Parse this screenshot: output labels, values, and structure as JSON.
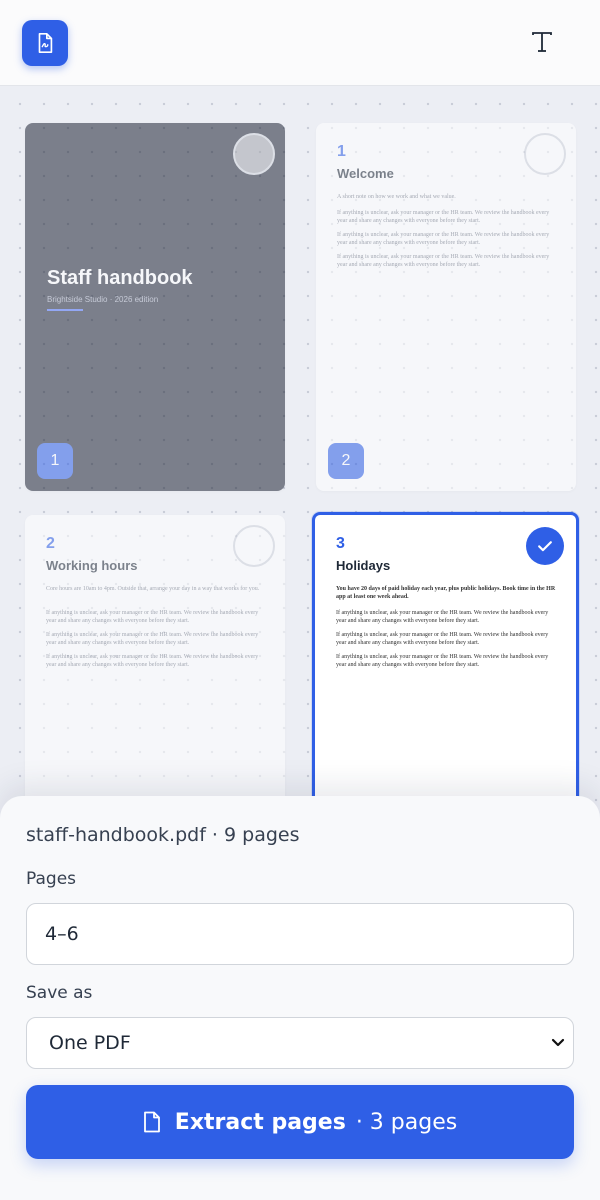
{
  "toolbar": {
    "app_icon": "pdf-file-icon",
    "text_tool_icon": "text-tool-icon",
    "text_tool_glyph": "T"
  },
  "pages": [
    {
      "page": "1",
      "type": "cover",
      "title": "Staff handbook",
      "subtitle": "Brightside Studio · 2026 edition",
      "badge": "1",
      "selected": false
    },
    {
      "page": "2",
      "number": "1",
      "title": "Welcome",
      "lead": "A short note on how we work and what we value.",
      "paragraph": "If anything is unclear, ask your manager or the HR team. We review the handbook every year and share any changes with everyone before they start.",
      "badge": "2",
      "selected": false
    },
    {
      "page": "3",
      "number": "2",
      "title": "Working hours",
      "lead": "Core hours are 10am to 4pm. Outside that, arrange your day in a way that works for you.",
      "paragraph": "If anything is unclear, ask your manager or the HR team. We review the handbook every year and share any changes with everyone before they start.",
      "selected": false
    },
    {
      "page": "4",
      "number": "3",
      "title": "Holidays",
      "lead": "You have 20 days of paid holiday each year, plus public holidays. Book time in the HR app at least one week ahead.",
      "paragraph": "If anything is unclear, ask your manager or the HR team. We review the handbook every year and share any changes with everyone before they start.",
      "selected": true
    }
  ],
  "sheet": {
    "file_info": "staff-handbook.pdf · 9 pages",
    "pages_label": "Pages",
    "pages_value": "4–6",
    "save_as_label": "Save as",
    "save_as_value": "One PDF",
    "extract_label": "Extract pages",
    "extract_count": "· 3 pages"
  },
  "colors": {
    "accent": "#2f5fe6",
    "cover_bg": "#1f2536"
  }
}
